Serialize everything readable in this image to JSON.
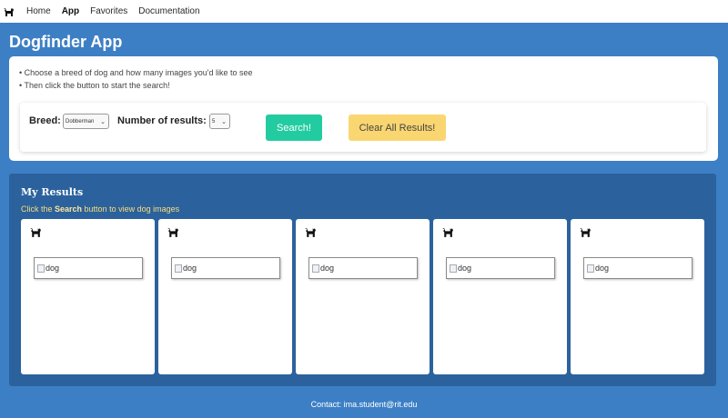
{
  "nav": {
    "logo_icon": "dog-icon",
    "items": [
      {
        "label": "Home",
        "active": false
      },
      {
        "label": "App",
        "active": true
      },
      {
        "label": "Favorites",
        "active": false
      },
      {
        "label": "Documentation",
        "active": false
      }
    ]
  },
  "app": {
    "title": "Dogfinder App"
  },
  "instructions": {
    "line1": "• Choose a breed of dog and how many images you'd like to see",
    "line2": "• Then click the button to start the search!"
  },
  "controls": {
    "breed_label": "Breed:",
    "breed_selected": "Dobberman",
    "num_label": "Number of results:",
    "num_selected": "5",
    "search_label": "Search!",
    "clear_label": "Clear All Results!"
  },
  "results": {
    "title": "My Results",
    "hint_prefix": "Click the ",
    "hint_bold": "Search",
    "hint_suffix": " button to view dog images",
    "cards": [
      {
        "alt": "dog"
      },
      {
        "alt": "dog"
      },
      {
        "alt": "dog"
      },
      {
        "alt": "dog"
      },
      {
        "alt": "dog"
      }
    ]
  },
  "footer": {
    "contact": "Contact: ima.student@rit.edu"
  },
  "colors": {
    "background": "#3d7fc4",
    "results_panel": "#2b629d",
    "search_button": "#23cca0",
    "clear_button": "#fad671",
    "hint_text": "#fadc7a"
  }
}
